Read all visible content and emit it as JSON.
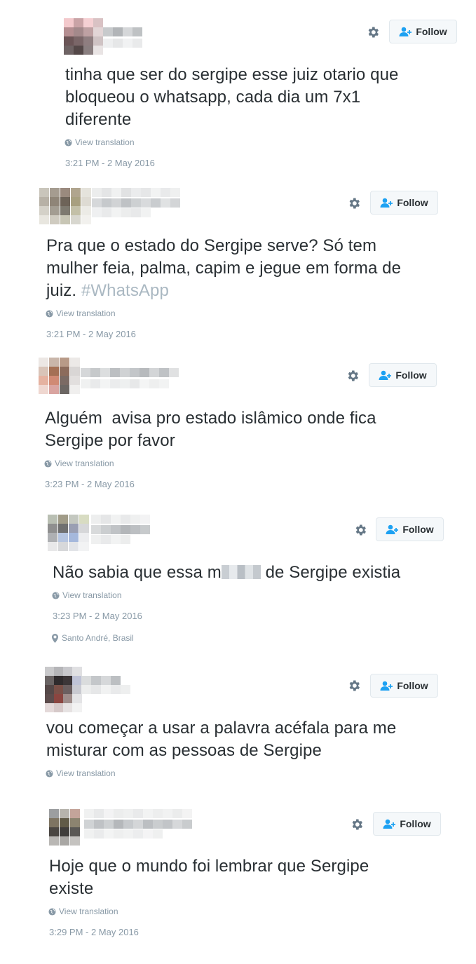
{
  "follow_label": "Follow",
  "view_translation": "View translation",
  "tweets": [
    {
      "lines": [
        "tinha que ser do sergipe esse juiz otario que",
        "bloqueou o whatsapp, cada dia um 7x1",
        "diferente"
      ],
      "timestamp": "3:21 PM - 2 May 2016"
    },
    {
      "lines": [
        "Pra que o estado do Sergipe serve? Só tem",
        "mulher feia, palma, capim e jegue em forma de",
        "juiz. "
      ],
      "hashtag": "#WhatsApp",
      "timestamp": "3:21 PM - 2 May 2016"
    },
    {
      "lines": [
        "Alguém  avisa pro estado islâmico onde fica",
        "Sergipe por favor"
      ],
      "timestamp": "3:23 PM - 2 May 2016"
    },
    {
      "line_before_blur": "Não sabia que essa m",
      "line_after_blur": " de Sergipe existia",
      "timestamp": "3:23 PM - 2 May 2016",
      "location": "Santo André, Brasil"
    },
    {
      "lines": [
        "vou começar a usar a palavra acéfala para me",
        "misturar com as pessoas de Sergipe"
      ]
    },
    {
      "lines": [
        "Hoje que o mundo foi lembrar que Sergipe",
        "existe"
      ],
      "timestamp": "3:29 PM - 2 May 2016"
    }
  ],
  "icons": {
    "gear": "gear-icon",
    "follow": "add-user-icon",
    "globe": "globe-icon",
    "location": "location-pin-icon"
  },
  "colors": {
    "text": "#292f33",
    "muted": "#8899a6",
    "hashtag": "#aab8c2",
    "accent": "#1da1f2",
    "button_bg": "#f5f8fa",
    "button_border": "#e1e8ed"
  }
}
